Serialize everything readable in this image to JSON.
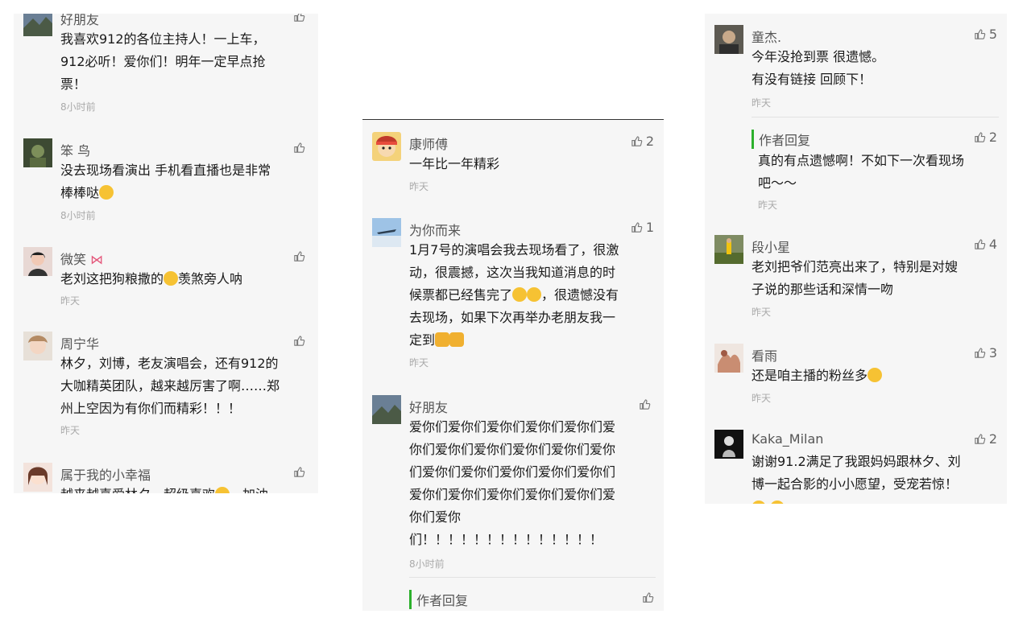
{
  "left": {
    "comments": [
      {
        "name": "好朋友",
        "likes": "",
        "text": "我喜欢912的各位主持人！一上车，\n912必听！爱你们！明年一定早点抢\n票！",
        "time": "8小时前"
      },
      {
        "name": "笨 鸟",
        "likes": "",
        "text": "没去现场看演出 手机看直播也是非常\n棒棒哒",
        "time": "8小时前"
      },
      {
        "name": "微笑",
        "likes": "",
        "text": "老刘这把狗粮撒的",
        "text_after": "羡煞旁人呐",
        "time": "昨天"
      },
      {
        "name": "周宁华",
        "likes": "",
        "text": "林夕，刘博，老友演唱会，还有912的\n大咖精英团队，越来越厉害了啊……郑\n州上空因为有你们而精彩！！！",
        "time": "昨天"
      },
      {
        "name": "属于我的小幸福",
        "likes": "",
        "text": "越来越喜爱林夕，超级喜欢",
        "text_after": "，加油",
        "time": ""
      }
    ]
  },
  "middle": {
    "comments": [
      {
        "name": "康师傅",
        "likes": "2",
        "text": "一年比一年精彩",
        "time": "昨天"
      },
      {
        "name": "为你而来",
        "likes": "1",
        "text": "1月7号的演唱会我去现场看了，很激\n动，很震撼，这次当我知道消息的时\n候票都已经售完了",
        "text_after": "，很遗憾没有\n去现场，如果下次再举办老朋友我一\n定到",
        "time": "昨天"
      },
      {
        "name": "好朋友",
        "likes": "",
        "text": "爱你们爱你们爱你们爱你们爱你们爱\n你们爱你们爱你们爱你们爱你们爱你\n们爱你们爱你们爱你们爱你们爱你们\n爱你们爱你们爱你们爱你们爱你们爱\n你们爱你\n们！！！！！！！！！！！！！！",
        "time": "8小时前"
      }
    ],
    "reply_label": "作者回复"
  },
  "right": {
    "comments": [
      {
        "name": "童杰.",
        "likes": "5",
        "text": "今年没抢到票 很遗憾。\n有没有链接 回顾下！",
        "time": "昨天"
      },
      {
        "name": "段小星",
        "likes": "4",
        "text": "老刘把爷们范亮出来了，特别是对嫂\n子说的那些话和深情一吻",
        "time": "昨天"
      },
      {
        "name": "看雨",
        "likes": "3",
        "text": "还是咱主播的粉丝多",
        "time": "昨天"
      },
      {
        "name": "Kaka_Milan",
        "likes": "2",
        "text": "谢谢91.2满足了我跟妈妈跟林夕、刘\n博一起合影的小小愿望，受宠若惊！",
        "time": ""
      }
    ],
    "reply": {
      "label": "作者回复",
      "likes": "2",
      "text": "真的有点遗憾啊！不如下一次看现场\n吧～～",
      "time": "昨天"
    }
  },
  "colors": {
    "panel_bg": "#f6f6f6",
    "reply_bar": "#2cb02c",
    "muted": "#aaaaaa"
  },
  "icons": {
    "like": "thumbs-up-icon"
  }
}
